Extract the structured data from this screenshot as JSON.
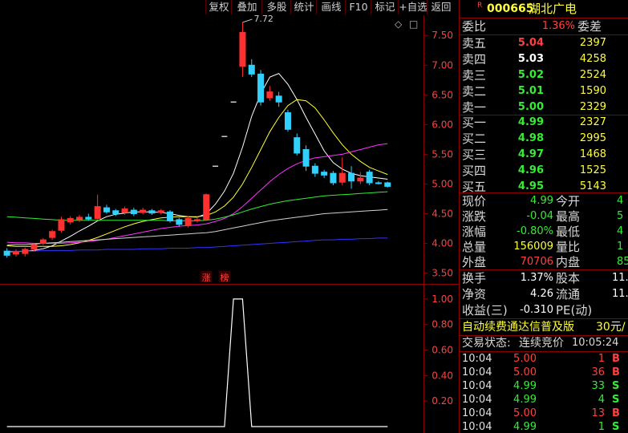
{
  "toolbar": {
    "buttons": [
      "复权",
      "叠加",
      "多股",
      "统计",
      "画线",
      "F10",
      "标记",
      "+自选",
      "返回"
    ]
  },
  "header": {
    "r_badge": "R",
    "code": "000665",
    "name": "湖北广电"
  },
  "weibi": {
    "label": "委比",
    "value": "1.36%",
    "label2": "委差"
  },
  "asks": [
    {
      "label": "卖五",
      "price": "5.04",
      "vol": "2397",
      "color": "#ff4040"
    },
    {
      "label": "卖四",
      "price": "5.03",
      "vol": "4258",
      "color": "#ffffff"
    },
    {
      "label": "卖三",
      "price": "5.02",
      "vol": "2524",
      "color": "#33ee33"
    },
    {
      "label": "卖二",
      "price": "5.01",
      "vol": "1590",
      "color": "#33ee33"
    },
    {
      "label": "卖一",
      "price": "5.00",
      "vol": "2329",
      "color": "#33ee33"
    }
  ],
  "bids": [
    {
      "label": "买一",
      "price": "4.99",
      "vol": "2327",
      "color": "#33ee33"
    },
    {
      "label": "买二",
      "price": "4.98",
      "vol": "2995",
      "color": "#33ee33"
    },
    {
      "label": "买三",
      "price": "4.97",
      "vol": "1468",
      "color": "#33ee33"
    },
    {
      "label": "买四",
      "price": "4.96",
      "vol": "1525",
      "color": "#33ee33"
    },
    {
      "label": "买五",
      "price": "4.95",
      "vol": "5143",
      "color": "#33ee33"
    }
  ],
  "quote": [
    {
      "l1": "现价",
      "v1": "4.99",
      "c1": "#33ee33",
      "l2": "今开",
      "v2": "4"
    },
    {
      "l1": "涨跌",
      "v1": "-0.04",
      "c1": "#33ee33",
      "l2": "最高",
      "v2": "5"
    },
    {
      "l1": "涨幅",
      "v1": "-0.80%",
      "c1": "#33ee33",
      "l2": "最低",
      "v2": "4"
    },
    {
      "l1": "总量",
      "v1": "156009",
      "c1": "#ffff33",
      "l2": "量比",
      "v2": "1"
    },
    {
      "l1": "外盘",
      "v1": "70706",
      "c1": "#ff4040",
      "l2": "内盘",
      "v2": "85"
    }
  ],
  "finance": [
    {
      "l1": "换手",
      "v1": "1.37%",
      "l2": "股本",
      "v2": "11."
    },
    {
      "l1": "净资",
      "v1": "4.26",
      "l2": "流通",
      "v2": "11."
    },
    {
      "l1": "收益(三)",
      "v1": "-0.310",
      "l2": "PE(动)",
      "v2": ""
    }
  ],
  "ad": {
    "text": "自动续费通达信普及版",
    "price": "30元/"
  },
  "trade_status": {
    "label": "交易状态:",
    "value": "连续竞价",
    "time": "10:05:24"
  },
  "ticks": [
    {
      "time": "10:04",
      "price": "5.00",
      "vol": "1",
      "side": "B"
    },
    {
      "time": "10:04",
      "price": "5.00",
      "vol": "36",
      "side": "B"
    },
    {
      "time": "10:04",
      "price": "4.99",
      "vol": "33",
      "side": "S"
    },
    {
      "time": "10:04",
      "price": "4.99",
      "vol": "4",
      "side": "S"
    },
    {
      "time": "10:04",
      "price": "5.00",
      "vol": "13",
      "side": "B"
    },
    {
      "time": "10:04",
      "price": "4.99",
      "vol": "1",
      "side": "S"
    }
  ],
  "chart_data": [
    {
      "type": "candlestick",
      "ylim": [
        3.4,
        7.8
      ],
      "yticks": [
        "7.50",
        "7.00",
        "6.50",
        "6.00",
        "5.50",
        "5.00",
        "4.50",
        "4.00",
        "3.50"
      ],
      "ytick_values": [
        7.5,
        7.0,
        6.5,
        6.0,
        5.5,
        5.0,
        4.5,
        4.0,
        3.5
      ],
      "max_annotation": "7.72",
      "markers": [
        {
          "text": "涨",
          "index": 22
        },
        {
          "text": "榜",
          "index": 24
        }
      ],
      "candles": [
        {
          "o": 3.87,
          "c": 3.8,
          "h": 3.92,
          "l": 3.76
        },
        {
          "o": 3.82,
          "c": 3.86,
          "h": 3.9,
          "l": 3.78
        },
        {
          "o": 3.83,
          "c": 3.9,
          "h": 3.93,
          "l": 3.78
        },
        {
          "o": 3.9,
          "c": 3.98,
          "h": 4.01,
          "l": 3.87
        },
        {
          "o": 4.0,
          "c": 4.06,
          "h": 4.09,
          "l": 3.97
        },
        {
          "o": 4.1,
          "c": 4.2,
          "h": 4.23,
          "l": 4.06
        },
        {
          "o": 4.22,
          "c": 4.4,
          "h": 4.45,
          "l": 4.18
        },
        {
          "o": 4.36,
          "c": 4.42,
          "h": 4.46,
          "l": 4.32
        },
        {
          "o": 4.4,
          "c": 4.44,
          "h": 4.48,
          "l": 4.36
        },
        {
          "o": 4.44,
          "c": 4.41,
          "h": 4.5,
          "l": 4.38
        },
        {
          "o": 4.42,
          "c": 4.62,
          "h": 4.82,
          "l": 4.4
        },
        {
          "o": 4.6,
          "c": 4.53,
          "h": 4.65,
          "l": 4.5
        },
        {
          "o": 4.55,
          "c": 4.5,
          "h": 4.58,
          "l": 4.46
        },
        {
          "o": 4.52,
          "c": 4.58,
          "h": 4.62,
          "l": 4.48
        },
        {
          "o": 4.56,
          "c": 4.5,
          "h": 4.6,
          "l": 4.46
        },
        {
          "o": 4.52,
          "c": 4.56,
          "h": 4.6,
          "l": 4.49
        },
        {
          "o": 4.55,
          "c": 4.51,
          "h": 4.58,
          "l": 4.48
        },
        {
          "o": 4.52,
          "c": 4.55,
          "h": 4.58,
          "l": 4.49
        },
        {
          "o": 4.53,
          "c": 4.38,
          "h": 4.56,
          "l": 4.35
        },
        {
          "o": 4.4,
          "c": 4.32,
          "h": 4.43,
          "l": 4.28
        },
        {
          "o": 4.3,
          "c": 4.42,
          "h": 4.46,
          "l": 4.27
        },
        {
          "o": 4.4,
          "c": 4.4,
          "h": 4.45,
          "l": 4.35
        },
        {
          "o": 4.4,
          "c": 4.82,
          "h": 4.84,
          "l": 4.38
        },
        {
          "o": 5.3,
          "c": 5.3,
          "h": 5.3,
          "l": 5.3
        },
        {
          "o": 5.8,
          "c": 5.8,
          "h": 5.8,
          "l": 5.8
        },
        {
          "o": 6.38,
          "c": 6.38,
          "h": 6.38,
          "l": 6.38
        },
        {
          "o": 6.98,
          "c": 7.55,
          "h": 7.72,
          "l": 6.8
        },
        {
          "o": 7.0,
          "c": 6.85,
          "h": 7.1,
          "l": 6.8
        },
        {
          "o": 6.85,
          "c": 6.38,
          "h": 6.92,
          "l": 6.32
        },
        {
          "o": 6.45,
          "c": 6.55,
          "h": 6.65,
          "l": 6.4
        },
        {
          "o": 6.48,
          "c": 6.38,
          "h": 6.55,
          "l": 6.3
        },
        {
          "o": 6.2,
          "c": 5.92,
          "h": 6.25,
          "l": 5.88
        },
        {
          "o": 5.78,
          "c": 5.52,
          "h": 5.85,
          "l": 5.48
        },
        {
          "o": 5.58,
          "c": 5.3,
          "h": 5.65,
          "l": 5.22
        },
        {
          "o": 5.3,
          "c": 5.18,
          "h": 5.35,
          "l": 5.12
        },
        {
          "o": 5.2,
          "c": 5.15,
          "h": 5.24,
          "l": 5.1
        },
        {
          "o": 5.18,
          "c": 5.02,
          "h": 5.22,
          "l": 4.98
        },
        {
          "o": 5.03,
          "c": 5.18,
          "h": 5.45,
          "l": 4.98
        },
        {
          "o": 5.18,
          "c": 5.05,
          "h": 5.3,
          "l": 4.92
        },
        {
          "o": 5.05,
          "c": 5.1,
          "h": 5.2,
          "l": 5.0
        },
        {
          "o": 5.2,
          "c": 5.02,
          "h": 5.24,
          "l": 4.98
        },
        {
          "o": 5.02,
          "c": 5.01,
          "h": 5.05,
          "l": 4.99
        },
        {
          "o": 5.02,
          "c": 4.96,
          "h": 5.04,
          "l": 4.94
        }
      ],
      "ma_lines": [
        {
          "color": "#ffffff",
          "start": 0,
          "values": [
            3.86,
            3.86,
            3.87,
            3.88,
            3.91,
            3.96,
            4.04,
            4.12,
            4.21,
            4.29,
            4.38,
            4.45,
            4.49,
            4.51,
            4.53,
            4.53,
            4.53,
            4.52,
            4.5,
            4.47,
            4.45,
            4.44,
            4.5,
            4.66,
            4.88,
            5.18,
            5.62,
            6.14,
            6.52,
            6.8,
            6.86,
            6.68,
            6.42,
            6.12,
            5.84,
            5.56,
            5.36,
            5.25,
            5.18,
            5.14,
            5.12,
            5.1,
            5.08
          ]
        },
        {
          "color": "#ffff33",
          "start": 0,
          "values": [
            3.96,
            3.95,
            3.95,
            3.95,
            3.95,
            3.95,
            3.96,
            3.98,
            4.01,
            4.05,
            4.1,
            4.16,
            4.22,
            4.28,
            4.33,
            4.37,
            4.4,
            4.43,
            4.44,
            4.45,
            4.45,
            4.45,
            4.47,
            4.53,
            4.63,
            4.78,
            5.0,
            5.28,
            5.58,
            5.88,
            6.12,
            6.32,
            6.42,
            6.4,
            6.28,
            6.08,
            5.86,
            5.66,
            5.5,
            5.38,
            5.28,
            5.22,
            5.16
          ]
        },
        {
          "color": "#ff33ff",
          "start": 0,
          "values": [
            4.02,
            4.01,
            4.01,
            4.0,
            4.0,
            4.0,
            4.0,
            4.01,
            4.02,
            4.03,
            4.05,
            4.07,
            4.1,
            4.13,
            4.16,
            4.19,
            4.22,
            4.25,
            4.27,
            4.29,
            4.3,
            4.31,
            4.33,
            4.37,
            4.42,
            4.5,
            4.62,
            4.76,
            4.9,
            5.04,
            5.16,
            5.26,
            5.34,
            5.4,
            5.44,
            5.46,
            5.48,
            5.5,
            5.54,
            5.58,
            5.62,
            5.66,
            5.68
          ]
        },
        {
          "color": "#33ee33",
          "start": 0,
          "values": [
            4.45,
            4.44,
            4.43,
            4.42,
            4.41,
            4.4,
            4.39,
            4.39,
            4.39,
            4.39,
            4.39,
            4.39,
            4.39,
            4.39,
            4.39,
            4.39,
            4.39,
            4.39,
            4.38,
            4.38,
            4.38,
            4.38,
            4.39,
            4.41,
            4.44,
            4.48,
            4.53,
            4.58,
            4.62,
            4.66,
            4.69,
            4.72,
            4.74,
            4.76,
            4.78,
            4.8,
            4.81,
            4.82,
            4.83,
            4.84,
            4.85,
            4.86,
            4.87
          ]
        },
        {
          "color": "#d0d0d0",
          "start": 0,
          "values": [
            3.97,
            3.98,
            3.98,
            3.99,
            4.0,
            4.01,
            4.02,
            4.03,
            4.04,
            4.05,
            4.06,
            4.07,
            4.08,
            4.09,
            4.1,
            4.11,
            4.12,
            4.13,
            4.14,
            4.15,
            4.16,
            4.17,
            4.18,
            4.2,
            4.23,
            4.26,
            4.29,
            4.32,
            4.35,
            4.38,
            4.4,
            4.42,
            4.44,
            4.46,
            4.48,
            4.5,
            4.51,
            4.52,
            4.53,
            4.54,
            4.55,
            4.56,
            4.57
          ]
        },
        {
          "color": "#3333ff",
          "start": 0,
          "values": [
            3.87,
            3.87,
            3.87,
            3.87,
            3.88,
            3.88,
            3.88,
            3.88,
            3.89,
            3.89,
            3.89,
            3.9,
            3.9,
            3.9,
            3.9,
            3.91,
            3.91,
            3.91,
            3.92,
            3.92,
            3.92,
            3.93,
            3.93,
            3.94,
            3.95,
            3.96,
            3.97,
            3.98,
            3.99,
            4.0,
            4.01,
            4.02,
            4.03,
            4.04,
            4.05,
            4.06,
            4.06,
            4.07,
            4.07,
            4.08,
            4.08,
            4.09,
            4.09
          ]
        }
      ]
    },
    {
      "type": "line",
      "ylim": [
        0,
        1.1
      ],
      "yticks": [
        "1.00",
        "0.80",
        "0.60",
        "0.40",
        "0.20"
      ],
      "ytick_values": [
        1.0,
        0.8,
        0.6,
        0.4,
        0.2
      ],
      "values": [
        0,
        0,
        0,
        0,
        0,
        0,
        0,
        0,
        0,
        0,
        0,
        0,
        0,
        0,
        0,
        0,
        0,
        0,
        0,
        0,
        0,
        0,
        0,
        0,
        0,
        1,
        1,
        0,
        0,
        0,
        0,
        0,
        0,
        0,
        0,
        0,
        0,
        0,
        0,
        0,
        0,
        0,
        0
      ],
      "line_color": "#ffffff"
    }
  ]
}
